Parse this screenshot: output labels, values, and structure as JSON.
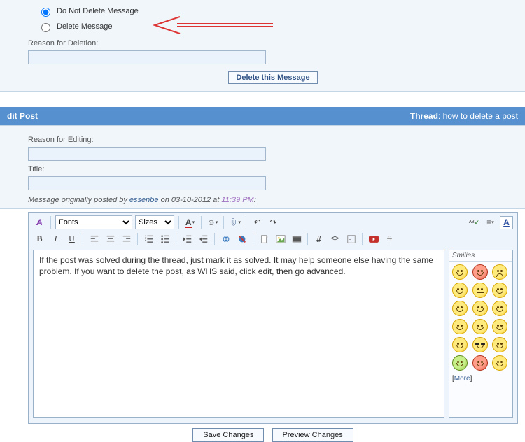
{
  "delete_panel": {
    "option_keep": "Do Not Delete Message",
    "option_delete": "Delete Message",
    "reason_label": "Reason for Deletion:",
    "reason_value": "",
    "delete_btn": "Delete this Message"
  },
  "header": {
    "left": "dit Post",
    "thread_label": "Thread",
    "thread_title": "how to delete a post"
  },
  "edit_panel": {
    "reason_label": "Reason for Editing:",
    "reason_value": "",
    "title_label": "Title:",
    "title_value": "",
    "msg_prefix": "Message originally posted by ",
    "author": "essenbe",
    "msg_mid": " on 03-10-2012 at ",
    "msg_time": "11:39 PM",
    "msg_suffix": ":"
  },
  "editor": {
    "font_sel": "Fonts",
    "size_sel": "Sizes",
    "text": "If the post was solved during the thread, just mark it as solved. It may help someone else having the same problem. If you want to delete the post, as WHS said, click edit, then go advanced."
  },
  "smilies": {
    "heading": "Smilies",
    "more_open": "[",
    "more_link": "More",
    "more_close": "]"
  },
  "buttons": {
    "save": "Save Changes",
    "preview": "Preview Changes"
  }
}
